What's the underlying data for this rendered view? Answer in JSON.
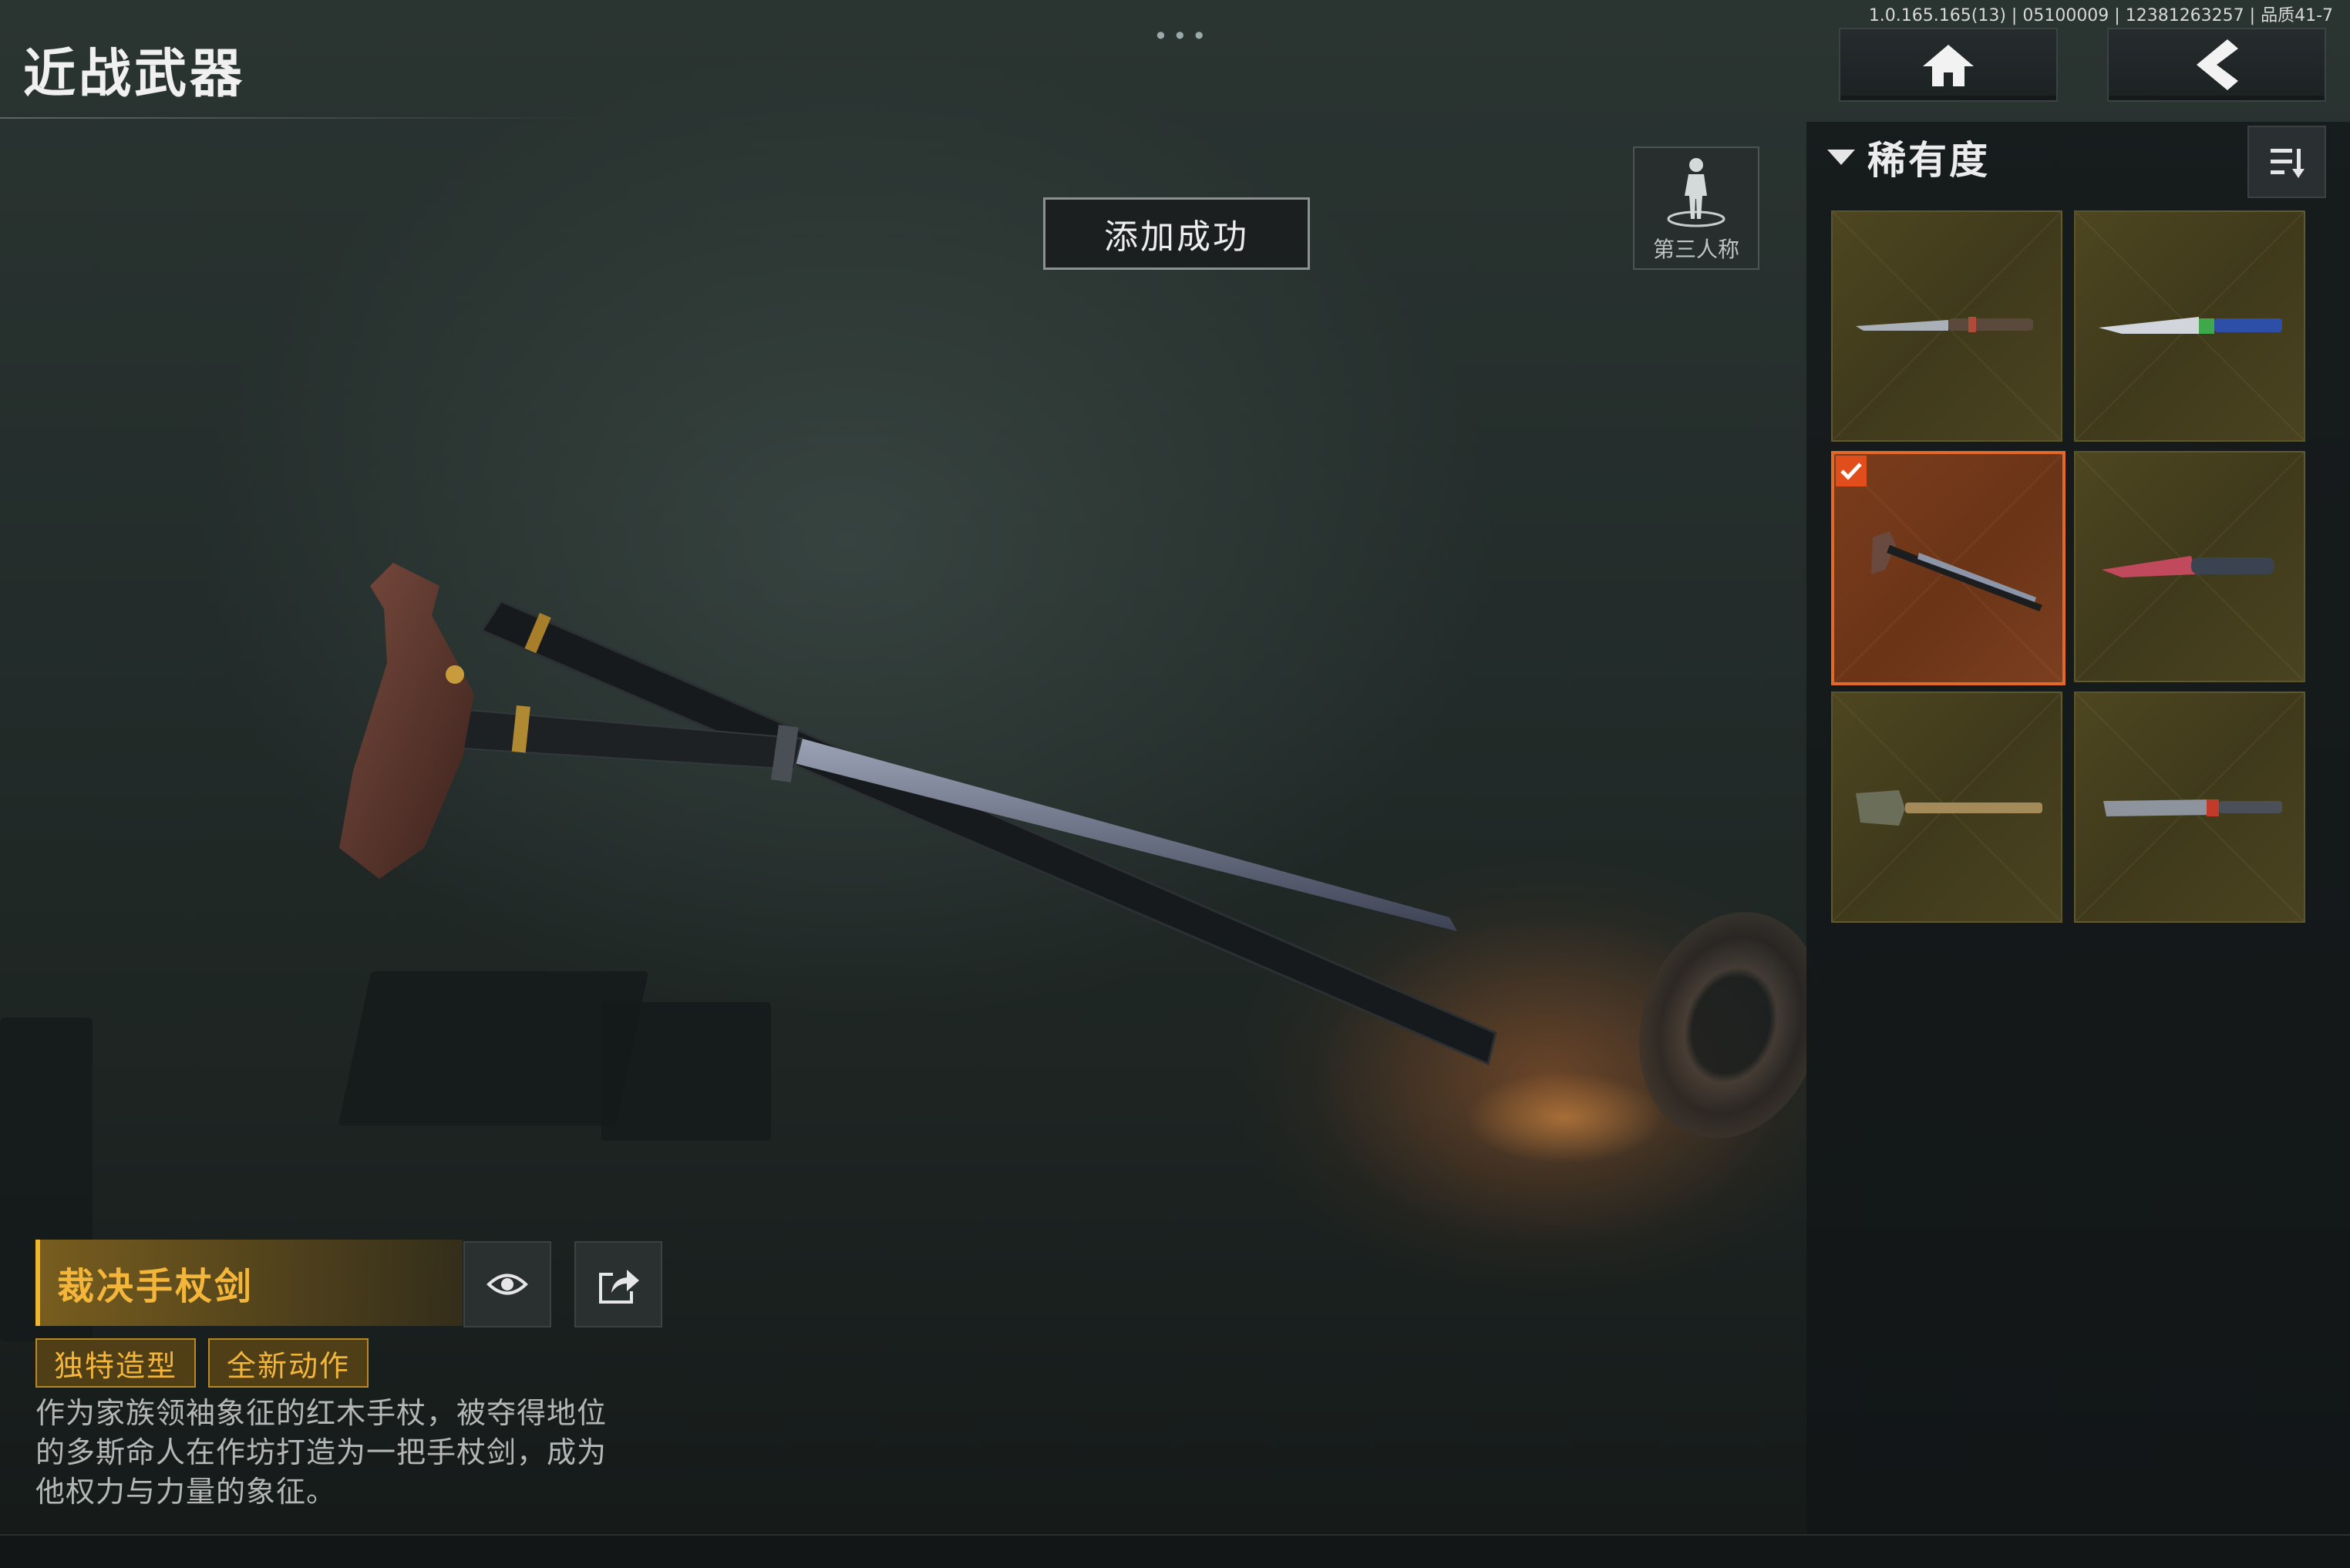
{
  "header": {
    "title": "近战武器",
    "version_info": "1.0.165.165(13) | 05100009 | 12381263257 | 品质41-7",
    "home_icon": "home-icon",
    "back_icon": "chevron-left-icon"
  },
  "toast": {
    "text": "添加成功"
  },
  "perspective": {
    "label": "第三人称",
    "icon": "person-icon"
  },
  "sort": {
    "label": "稀有度",
    "icon": "sort-list-icon"
  },
  "inventory": {
    "items": [
      {
        "icon": "combat-knife-icon",
        "selected": false
      },
      {
        "icon": "tactical-knife-icon",
        "selected": false
      },
      {
        "icon": "sword-cane-icon",
        "selected": true
      },
      {
        "icon": "red-knife-icon",
        "selected": false
      },
      {
        "icon": "shovel-icon",
        "selected": false
      },
      {
        "icon": "machete-icon",
        "selected": false
      }
    ]
  },
  "weapon": {
    "name": "裁决手杖剑",
    "tags": [
      "独特造型",
      "全新动作"
    ],
    "description_lines": [
      "作为家族领袖象征的红木手杖，被夺得地位",
      "的多斯命人在作坊打造为一把手杖剑，成为",
      "他权力与力量的象征。"
    ],
    "preview_icon": "eye-icon",
    "share_icon": "share-icon"
  },
  "colors": {
    "accent_gold": "#f3b63a",
    "selected_orange": "#e16a2a",
    "rarity_gold": "#4d4620"
  }
}
